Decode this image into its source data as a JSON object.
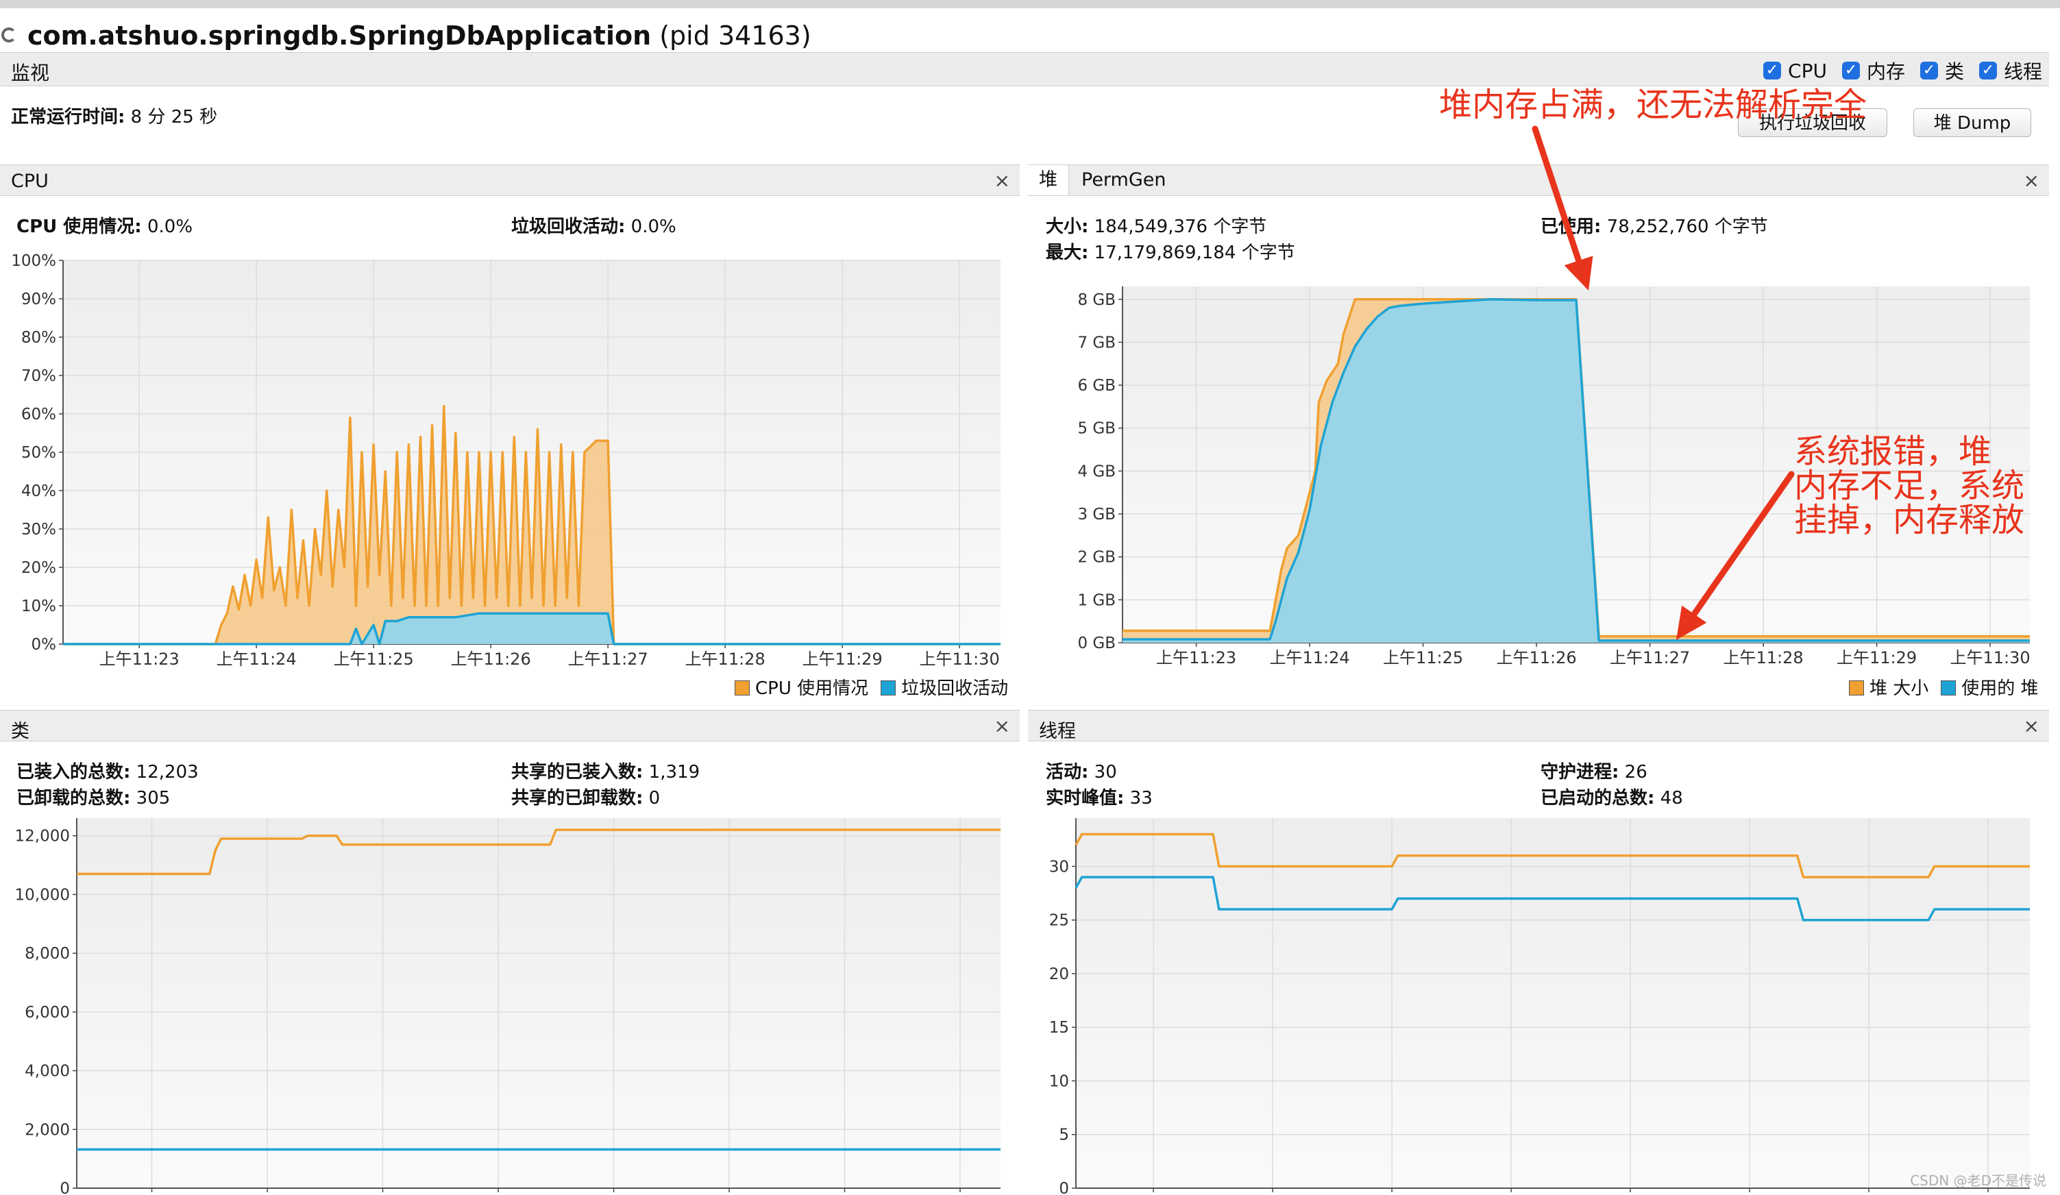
{
  "window": {
    "app_name": "com.atshuo.springdb.SpringDbApplication",
    "pid": "(pid 34163)"
  },
  "monitor": {
    "title": "监视",
    "checkboxes": [
      {
        "label": "CPU",
        "checked": true
      },
      {
        "label": "内存",
        "checked": true
      },
      {
        "label": "类",
        "checked": true
      },
      {
        "label": "线程",
        "checked": true
      }
    ],
    "uptime_label": "正常运行时间:",
    "uptime_value": "8 分 25 秒",
    "gc_button": "执行垃圾回收",
    "dump_button": "堆 Dump"
  },
  "cpu_panel": {
    "title": "CPU",
    "close": "×",
    "usage_label": "CPU 使用情况:",
    "usage_value": "0.0%",
    "gc_label": "垃圾回收活动:",
    "gc_value": "0.0%",
    "legend": [
      "CPU 使用情况",
      "垃圾回收活动"
    ]
  },
  "heap_panel": {
    "tab_heap": "堆",
    "tab_permgen": "PermGen",
    "close": "×",
    "size_label": "大小:",
    "size_value": "184,549,376 个字节",
    "used_label": "已使用:",
    "used_value": "78,252,760 个字节",
    "max_label": "最大:",
    "max_value": "17,179,869,184 个字节",
    "legend": [
      "堆 大小",
      "使用的 堆"
    ]
  },
  "classes_panel": {
    "title": "类",
    "close": "×",
    "loaded_label": "已装入的总数:",
    "loaded_value": "12,203",
    "unloaded_label": "已卸载的总数:",
    "unloaded_value": "305",
    "shared_loaded_label": "共享的已装入数:",
    "shared_loaded_value": "1,319",
    "shared_unloaded_label": "共享的已卸载数:",
    "shared_unloaded_value": "0"
  },
  "threads_panel": {
    "title": "线程",
    "close": "×",
    "live_label": "活动:",
    "live_value": "30",
    "peak_label": "实时峰值:",
    "peak_value": "33",
    "daemon_label": "守护进程:",
    "daemon_value": "26",
    "started_label": "已启动的总数:",
    "started_value": "48"
  },
  "annotations": {
    "heap_full": "堆内存占满，还无法解析完全",
    "crash": [
      "系统报错，堆",
      "内存不足，系统",
      "挂掉，内存释放"
    ]
  },
  "watermark": "CSDN @老D不是传说",
  "colors": {
    "orange": "#f0a030",
    "orange_fill": "#f6c98b",
    "blue": "#1ea3d4",
    "blue_fill": "#8fd6ef",
    "arrow": "#e8341c"
  },
  "chart_data": [
    {
      "type": "area",
      "name": "CPU",
      "x": [
        "上午11:23",
        "上午11:24",
        "上午11:25",
        "上午11:26",
        "上午11:27",
        "上午11:28",
        "上午11:29",
        "上午11:30"
      ],
      "yticks": [
        "0%",
        "10%",
        "20%",
        "30%",
        "40%",
        "50%",
        "60%",
        "70%",
        "80%",
        "90%",
        "100%"
      ],
      "ylim": [
        0,
        100
      ],
      "xlim": [
        22.35,
        30.35
      ],
      "series": [
        {
          "name": "CPU 使用情况",
          "points": [
            [
              22.35,
              0
            ],
            [
              23.0,
              0
            ],
            [
              23.65,
              0
            ],
            [
              23.7,
              5
            ],
            [
              23.75,
              8
            ],
            [
              23.8,
              15
            ],
            [
              23.85,
              9
            ],
            [
              23.9,
              18
            ],
            [
              23.95,
              10
            ],
            [
              24.0,
              22
            ],
            [
              24.05,
              12
            ],
            [
              24.1,
              33
            ],
            [
              24.15,
              14
            ],
            [
              24.2,
              20
            ],
            [
              24.25,
              10
            ],
            [
              24.3,
              35
            ],
            [
              24.35,
              12
            ],
            [
              24.4,
              27
            ],
            [
              24.45,
              10
            ],
            [
              24.5,
              30
            ],
            [
              24.55,
              18
            ],
            [
              24.6,
              40
            ],
            [
              24.65,
              15
            ],
            [
              24.7,
              35
            ],
            [
              24.75,
              20
            ],
            [
              24.8,
              59
            ],
            [
              24.85,
              10
            ],
            [
              24.9,
              50
            ],
            [
              24.95,
              15
            ],
            [
              25.0,
              52
            ],
            [
              25.05,
              18
            ],
            [
              25.1,
              45
            ],
            [
              25.15,
              10
            ],
            [
              25.2,
              50
            ],
            [
              25.25,
              12
            ],
            [
              25.3,
              52
            ],
            [
              25.35,
              10
            ],
            [
              25.4,
              54
            ],
            [
              25.45,
              10
            ],
            [
              25.5,
              57
            ],
            [
              25.55,
              10
            ],
            [
              25.6,
              62
            ],
            [
              25.65,
              12
            ],
            [
              25.7,
              55
            ],
            [
              25.75,
              10
            ],
            [
              25.8,
              50
            ],
            [
              25.85,
              12
            ],
            [
              25.9,
              50
            ],
            [
              25.95,
              10
            ],
            [
              26.0,
              50
            ],
            [
              26.05,
              12
            ],
            [
              26.1,
              50
            ],
            [
              26.15,
              10
            ],
            [
              26.2,
              54
            ],
            [
              26.25,
              10
            ],
            [
              26.3,
              50
            ],
            [
              26.35,
              12
            ],
            [
              26.4,
              56
            ],
            [
              26.45,
              10
            ],
            [
              26.5,
              50
            ],
            [
              26.55,
              10
            ],
            [
              26.6,
              52
            ],
            [
              26.65,
              12
            ],
            [
              26.7,
              50
            ],
            [
              26.75,
              10
            ],
            [
              26.8,
              50
            ],
            [
              26.9,
              53
            ],
            [
              27.0,
              53
            ],
            [
              27.05,
              0
            ],
            [
              30.35,
              0
            ]
          ]
        },
        {
          "name": "垃圾回收活动",
          "points": [
            [
              22.35,
              0
            ],
            [
              24.8,
              0
            ],
            [
              24.85,
              4
            ],
            [
              24.9,
              0
            ],
            [
              25.0,
              5
            ],
            [
              25.05,
              0
            ],
            [
              25.1,
              6
            ],
            [
              25.2,
              6
            ],
            [
              25.3,
              7
            ],
            [
              25.5,
              7
            ],
            [
              25.7,
              7
            ],
            [
              25.9,
              8
            ],
            [
              26.1,
              8
            ],
            [
              26.3,
              8
            ],
            [
              26.5,
              8
            ],
            [
              26.7,
              8
            ],
            [
              27.0,
              8
            ],
            [
              27.05,
              0
            ],
            [
              30.35,
              0
            ]
          ]
        }
      ]
    },
    {
      "type": "area",
      "name": "堆",
      "x": [
        "上午11:23",
        "上午11:24",
        "上午11:25",
        "上午11:26",
        "上午11:27",
        "上午11:28",
        "上午11:29",
        "上午11:30"
      ],
      "yticks": [
        "0 GB",
        "1 GB",
        "2 GB",
        "3 GB",
        "4 GB",
        "5 GB",
        "6 GB",
        "7 GB",
        "8 GB"
      ],
      "ylim": [
        0,
        8.3
      ],
      "xlim": [
        22.35,
        30.35
      ],
      "series": [
        {
          "name": "堆 大小",
          "points": [
            [
              22.35,
              0.28
            ],
            [
              23.65,
              0.28
            ],
            [
              23.68,
              0.7
            ],
            [
              23.75,
              1.7
            ],
            [
              23.8,
              2.2
            ],
            [
              23.9,
              2.5
            ],
            [
              23.95,
              3.0
            ],
            [
              24.0,
              3.5
            ],
            [
              24.05,
              4.0
            ],
            [
              24.08,
              5.6
            ],
            [
              24.15,
              6.1
            ],
            [
              24.25,
              6.5
            ],
            [
              24.3,
              7.2
            ],
            [
              24.35,
              7.6
            ],
            [
              24.4,
              8.0
            ],
            [
              25.0,
              8.0
            ],
            [
              25.5,
              8.0
            ],
            [
              26.0,
              8.0
            ],
            [
              26.35,
              8.0
            ],
            [
              26.55,
              0.15
            ],
            [
              30.35,
              0.15
            ]
          ]
        },
        {
          "name": "使用的 堆",
          "points": [
            [
              22.35,
              0.08
            ],
            [
              23.65,
              0.08
            ],
            [
              23.7,
              0.5
            ],
            [
              23.8,
              1.5
            ],
            [
              23.9,
              2.1
            ],
            [
              24.0,
              3.1
            ],
            [
              24.1,
              4.6
            ],
            [
              24.2,
              5.6
            ],
            [
              24.3,
              6.3
            ],
            [
              24.4,
              6.9
            ],
            [
              24.5,
              7.3
            ],
            [
              24.6,
              7.6
            ],
            [
              24.7,
              7.8
            ],
            [
              24.8,
              7.85
            ],
            [
              25.0,
              7.9
            ],
            [
              25.3,
              7.95
            ],
            [
              25.6,
              8.0
            ],
            [
              26.0,
              7.98
            ],
            [
              26.35,
              7.98
            ],
            [
              26.55,
              0.05
            ],
            [
              30.35,
              0.05
            ]
          ]
        }
      ]
    },
    {
      "type": "line",
      "name": "类",
      "yticks": [
        "0",
        "2,000",
        "4,000",
        "6,000",
        "8,000",
        "10,000",
        "12,000"
      ],
      "ylim": [
        0,
        12600
      ],
      "xlim": [
        22.35,
        30.35
      ],
      "series": [
        {
          "name": "已装入的总数",
          "points": [
            [
              22.35,
              10700
            ],
            [
              23.5,
              10700
            ],
            [
              23.55,
              11500
            ],
            [
              23.6,
              11900
            ],
            [
              24.3,
              11900
            ],
            [
              24.35,
              12000
            ],
            [
              24.6,
              12000
            ],
            [
              24.65,
              11700
            ],
            [
              26.45,
              11700
            ],
            [
              26.5,
              12200
            ],
            [
              30.35,
              12203
            ]
          ]
        },
        {
          "name": "共享的已装入数",
          "points": [
            [
              22.35,
              1319
            ],
            [
              30.35,
              1319
            ]
          ]
        }
      ]
    },
    {
      "type": "line",
      "name": "线程",
      "yticks": [
        "0",
        "5",
        "10",
        "15",
        "20",
        "25",
        "30"
      ],
      "ylim": [
        0,
        34.5
      ],
      "xlim": [
        22.35,
        30.35
      ],
      "series": [
        {
          "name": "实时峰值",
          "points": [
            [
              22.35,
              32
            ],
            [
              22.4,
              33
            ],
            [
              23.5,
              33
            ],
            [
              23.55,
              30
            ],
            [
              25.0,
              30
            ],
            [
              25.05,
              31
            ],
            [
              28.4,
              31
            ],
            [
              28.45,
              29
            ],
            [
              29.5,
              29
            ],
            [
              29.55,
              30
            ],
            [
              30.35,
              30
            ]
          ]
        },
        {
          "name": "活动",
          "points": [
            [
              22.35,
              28
            ],
            [
              22.4,
              29
            ],
            [
              23.5,
              29
            ],
            [
              23.55,
              26
            ],
            [
              25.0,
              26
            ],
            [
              25.05,
              27
            ],
            [
              28.4,
              27
            ],
            [
              28.45,
              25
            ],
            [
              29.5,
              25
            ],
            [
              29.55,
              26
            ],
            [
              30.35,
              26
            ]
          ]
        }
      ]
    }
  ]
}
